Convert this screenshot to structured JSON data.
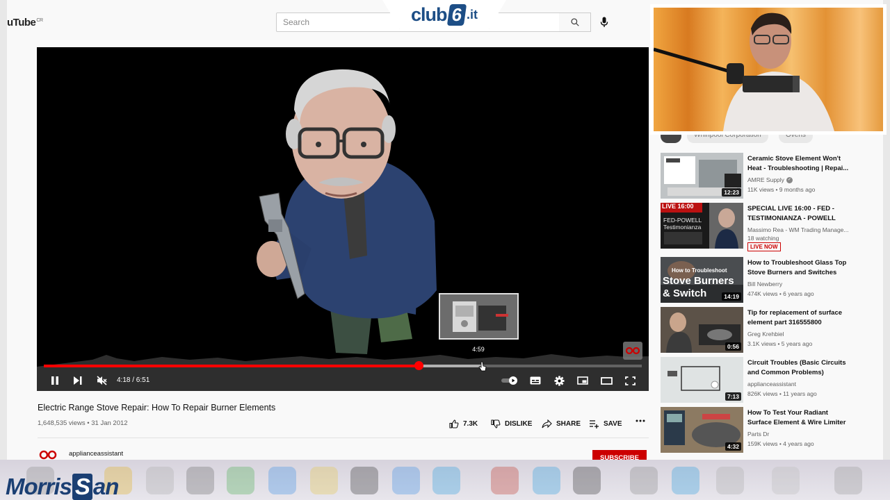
{
  "masthead": {
    "logo_text": "uTube",
    "logo_region": "CR",
    "search_placeholder": "Search"
  },
  "overlay_brand": {
    "club_text": "club",
    "club_number": "6",
    "club_tld": ".it"
  },
  "player": {
    "time_display": "4:18 / 6:51",
    "preview_time": "4:59",
    "played_fraction": 0.627,
    "buffered_fraction": 0.735
  },
  "video": {
    "title": "Electric Range Stove Repair: How To Repair Burner Elements",
    "meta": "1,648,535 views • 31 Jan 2012",
    "actions": {
      "like_count": "7.3K",
      "dislike_label": "DISLIKE",
      "share_label": "SHARE",
      "save_label": "SAVE"
    },
    "channel_name": "applianceassistant",
    "subscribe_label": "SUBSCRIBE"
  },
  "chips": [
    "Whirlpool Corporation",
    "Ovens"
  ],
  "recommendations": [
    {
      "title": "Ceramic Stove Element Won't Heat - Troubleshooting | Repai...",
      "channel": "AMRE Supply",
      "verified": true,
      "views": "11K views • 9 months ago",
      "duration": "12:23",
      "thumb_text": ""
    },
    {
      "title": "SPECIAL LIVE 16:00 - FED - TESTIMONIANZA - POWELL",
      "channel": "Massimo Rea - WM Trading Manage...",
      "verified": false,
      "views": "18 watching",
      "live_badge": "LIVE NOW",
      "thumb_text": "LIVE 16:00",
      "thumb_text2": "FED-POWELL Testimonianza"
    },
    {
      "title": "How to Troubleshoot Glass Top Stove Burners and Switches",
      "channel": "Bill Newberry",
      "verified": false,
      "views": "474K views • 6 years ago",
      "duration": "14:19",
      "thumb_text": "How to Troubleshoot",
      "thumb_text2": "Stove Burners",
      "thumb_text3": "& Switch"
    },
    {
      "title": "Tip for replacement of surface element part 316555800",
      "channel": "Greg Krehbiel",
      "verified": false,
      "views": "3.1K views • 5 years ago",
      "duration": "0:56",
      "thumb_text": ""
    },
    {
      "title": "Circuit Troubles (Basic Circuits and Common Problems)",
      "channel": "applianceassistant",
      "verified": false,
      "views": "826K views • 11 years ago",
      "duration": "7:13",
      "thumb_text": ""
    },
    {
      "title": "How To Test Your Radiant Surface Element & Wire Limiter",
      "channel": "Parts Dr",
      "verified": false,
      "views": "159K views • 4 years ago",
      "duration": "4:32",
      "thumb_text": ""
    }
  ],
  "corner_brand": {
    "part1": "Morris",
    "part2": "S",
    "part3": "an"
  },
  "colors": {
    "progress_played": "#ff0000",
    "subscribe": "#cc0000",
    "club6_blue": "#1d4e86"
  }
}
